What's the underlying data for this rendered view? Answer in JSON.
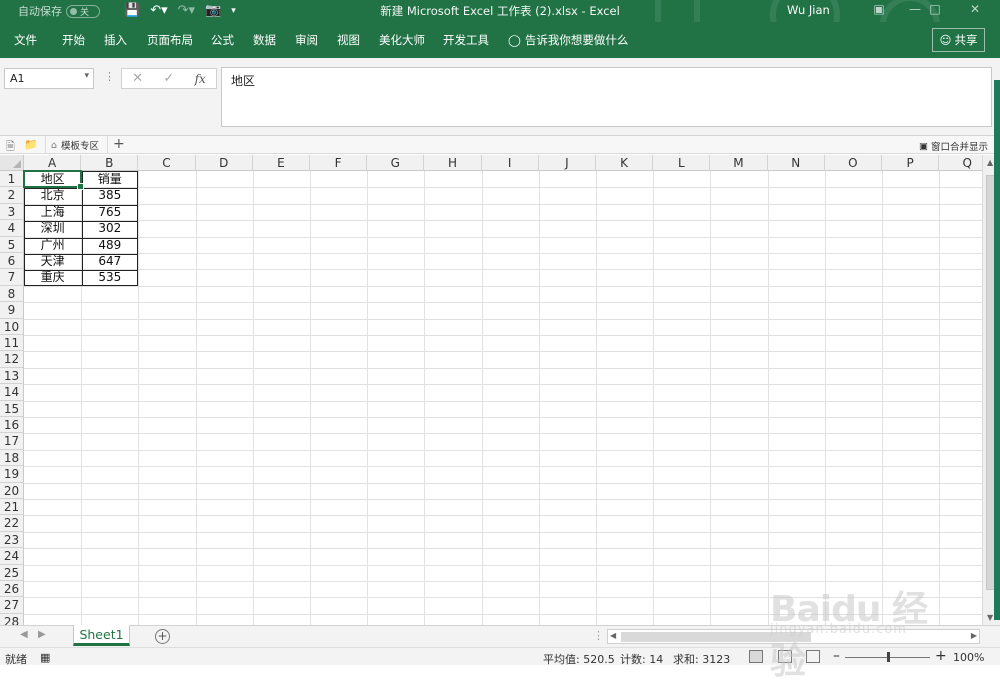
{
  "titlebar": {
    "autosave_label": "自动保存",
    "autosave_state": "关",
    "doc_title": "新建 Microsoft Excel 工作表 (2).xlsx  -  Excel",
    "user": "Wu Jian",
    "accent_color": "#217346"
  },
  "ribbon": {
    "tabs": [
      "文件",
      "开始",
      "插入",
      "页面布局",
      "公式",
      "数据",
      "审阅",
      "视图",
      "美化大师",
      "开发工具"
    ],
    "tell_me": "告诉我你想要做什么",
    "share": "共享"
  },
  "formula_bar": {
    "name_box": "A1",
    "fx_label": "fx",
    "content": "地区"
  },
  "doc_tabs": {
    "template_tab": "模板专区",
    "merge_show": "窗口合并显示"
  },
  "sheet": {
    "columns": [
      "A",
      "B",
      "C",
      "D",
      "E",
      "F",
      "G",
      "H",
      "I",
      "J",
      "K",
      "L",
      "M",
      "N",
      "O",
      "P",
      "Q"
    ],
    "rows": [
      "1",
      "2",
      "3",
      "4",
      "5",
      "6",
      "7",
      "8",
      "9",
      "10",
      "11",
      "12",
      "13",
      "14",
      "15",
      "16",
      "17",
      "18",
      "19",
      "20",
      "21",
      "22",
      "23",
      "24",
      "25",
      "26",
      "27",
      "28"
    ],
    "table": {
      "header": [
        "地区",
        "销量"
      ],
      "data": [
        [
          "北京",
          "385"
        ],
        [
          "上海",
          "765"
        ],
        [
          "深圳",
          "302"
        ],
        [
          "广州",
          "489"
        ],
        [
          "天津",
          "647"
        ],
        [
          "重庆",
          "535"
        ]
      ]
    }
  },
  "sheet_tabs": {
    "active": "Sheet1"
  },
  "status": {
    "ready": "就绪",
    "average": "平均值: 520.5",
    "count": "计数: 14",
    "sum": "求和: 3123",
    "zoom": "100%"
  },
  "watermark": {
    "brand": "Baidu 经验",
    "url": "jingyan.baidu.com"
  }
}
